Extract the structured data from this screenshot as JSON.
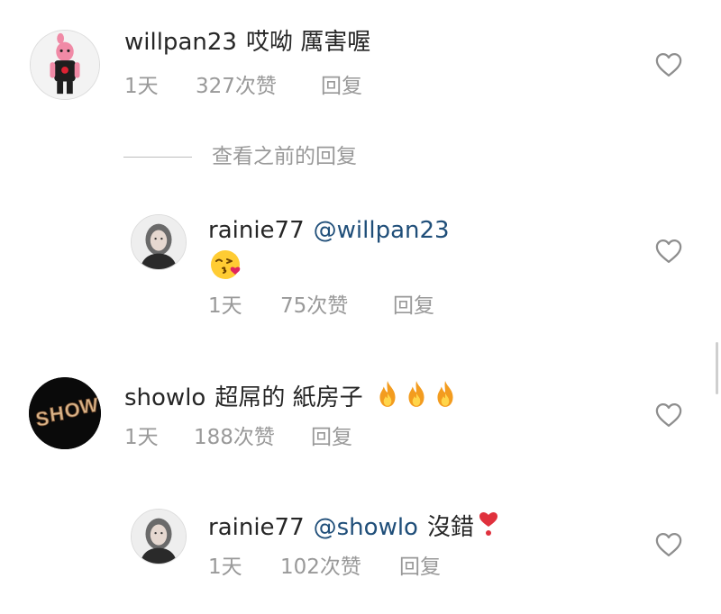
{
  "comments": [
    {
      "username": "willpan23",
      "text": "哎呦 厲害喔",
      "time": "1天",
      "likes": "327次赞",
      "reply_label": "回复",
      "avatar_icon": "baby-doll-avatar-icon"
    },
    {
      "username": "showlo",
      "text": "超屌的 紙房子",
      "emojis": [
        "fire-icon",
        "fire-icon",
        "fire-icon"
      ],
      "time": "1天",
      "likes": "188次赞",
      "reply_label": "回复",
      "avatar_icon": "show-logo-avatar-icon"
    }
  ],
  "view_previous_label": "查看之前的回复",
  "replies": [
    {
      "username": "rainie77",
      "mention": "@willpan23",
      "text": "",
      "emoji": "kissing-face-with-heart-icon",
      "time": "1天",
      "likes": "75次赞",
      "reply_label": "回复"
    },
    {
      "username": "rainie77",
      "mention": "@showlo",
      "text": "沒錯",
      "emoji": "red-heart-icon",
      "time": "1天",
      "likes": "102次赞",
      "reply_label": "回复"
    }
  ],
  "colors": {
    "primary_text": "#262626",
    "secondary_text": "#999999",
    "mention": "#1f4e79",
    "heart_outline": "#8e8e8e"
  }
}
